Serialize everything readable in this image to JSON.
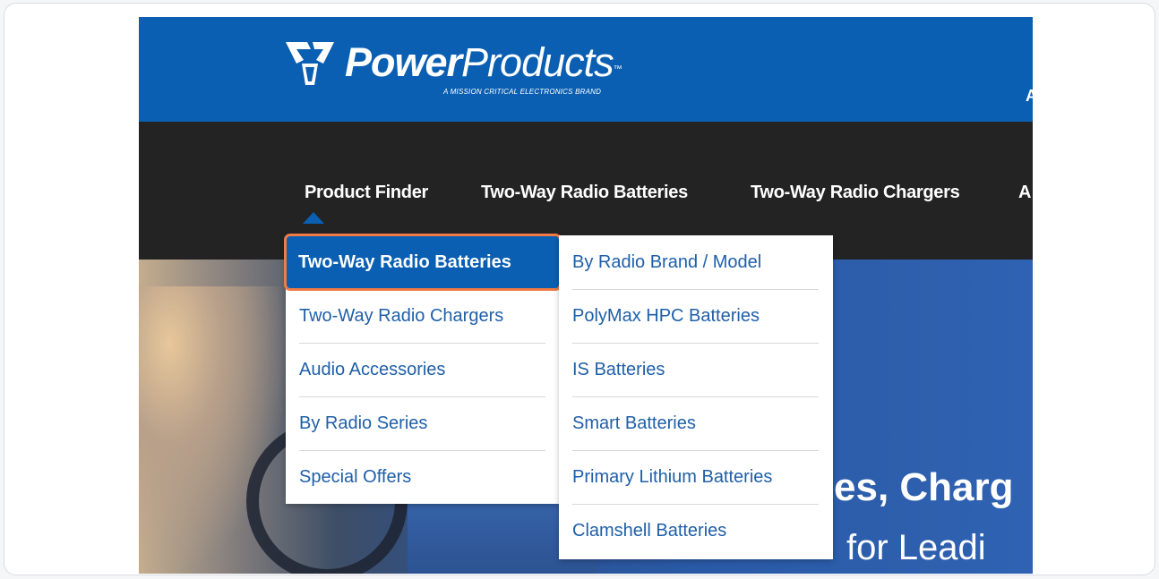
{
  "brand": {
    "name_bold": "Power",
    "name_light": "Products",
    "trademark": "™",
    "tagline": "A MISSION CRITICAL ELECTRONICS BRAND",
    "top_right_partial": "A",
    "colors": {
      "primary": "#0a5fb2",
      "nav_bg": "#232323",
      "highlight": "#f07b45"
    }
  },
  "nav": {
    "items": [
      "Product Finder",
      "Two-Way Radio Batteries",
      "Two-Way Radio Chargers",
      "A"
    ]
  },
  "dropdown": {
    "left": [
      "Two-Way Radio Batteries",
      "Two-Way Radio Chargers",
      "Audio Accessories",
      "By Radio Series",
      "Special Offers"
    ],
    "right": [
      "By Radio Brand / Model",
      "PolyMax HPC Batteries",
      "IS Batteries",
      "Smart Batteries",
      "Primary Lithium Batteries",
      "Clamshell Batteries"
    ]
  },
  "hero": {
    "headline_partial": "es, Charg",
    "sub_partial": "for Leadi"
  }
}
